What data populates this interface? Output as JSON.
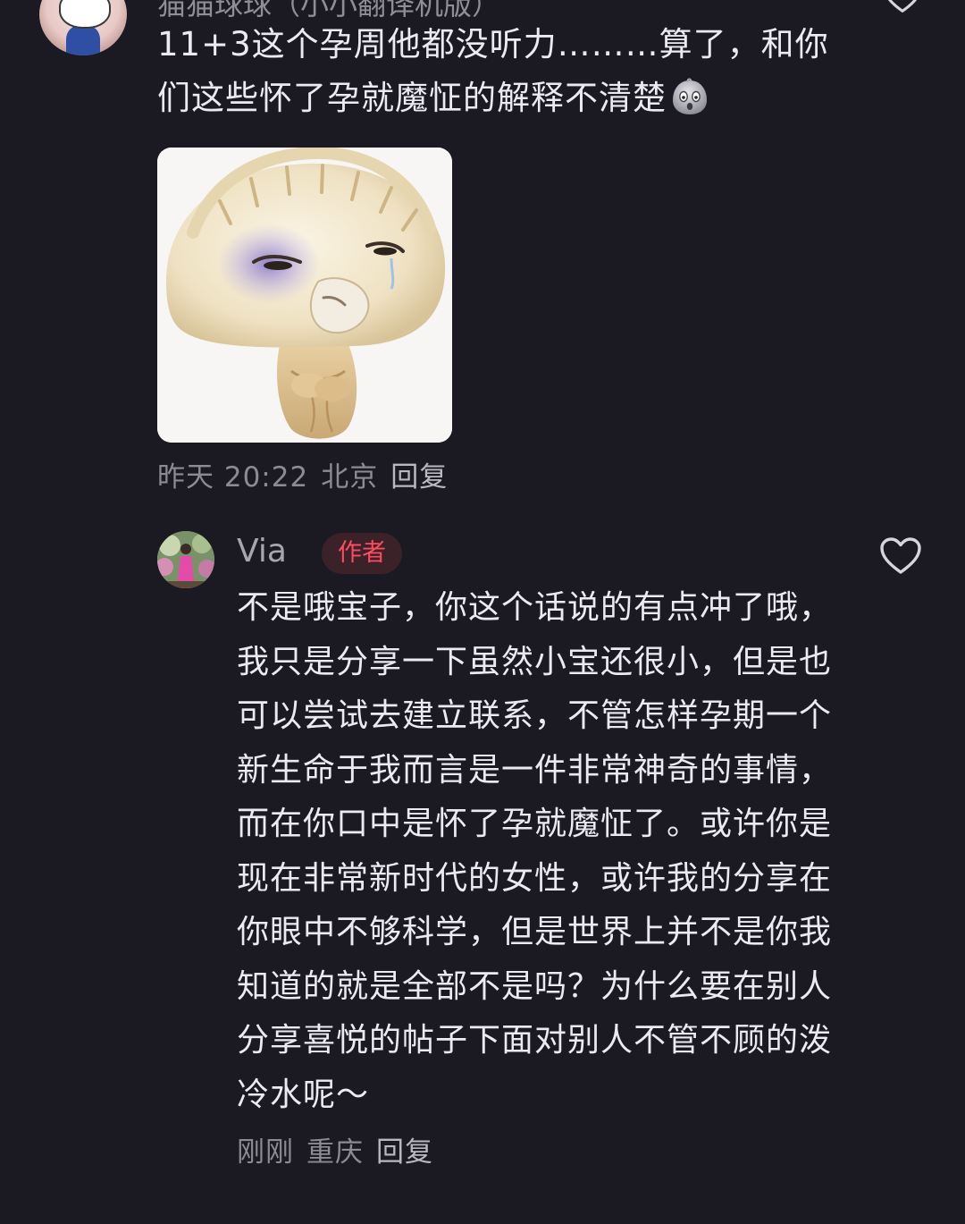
{
  "top_comment": {
    "username_cut": "猫猫球球（小小翻译机版）",
    "text": "11+3这个孕周他都没听力………算了，和你们这些怀了孕就魔怔的解释不清楚",
    "sticker_icon": "dumpling-meme-sticker",
    "time": "昨天 20:22",
    "location": "北京",
    "reply_label": "回复"
  },
  "reply_comment": {
    "username": "Via",
    "badge": "作者",
    "text": "不是哦宝子，你这个话说的有点冲了哦，我只是分享一下虽然小宝还很小，但是也可以尝试去建立联系，不管怎样孕期一个新生命于我而言是一件非常神奇的事情，而在你口中是怀了孕就魔怔了。或许你是现在非常新时代的女性，或许我的分享在你眼中不够科学，但是世界上并不是你我知道的就是全部不是吗？为什么要在别人分享喜悦的帖子下面对别人不管不顾的泼冷水呢～",
    "time": "刚刚",
    "location": "重庆",
    "reply_label": "回复"
  },
  "colors": {
    "background": "#1b1a23",
    "text": "#eceaf1",
    "meta": "#8c8b95",
    "badge_text": "#ff4b5f",
    "badge_bg": "#3a2228"
  }
}
